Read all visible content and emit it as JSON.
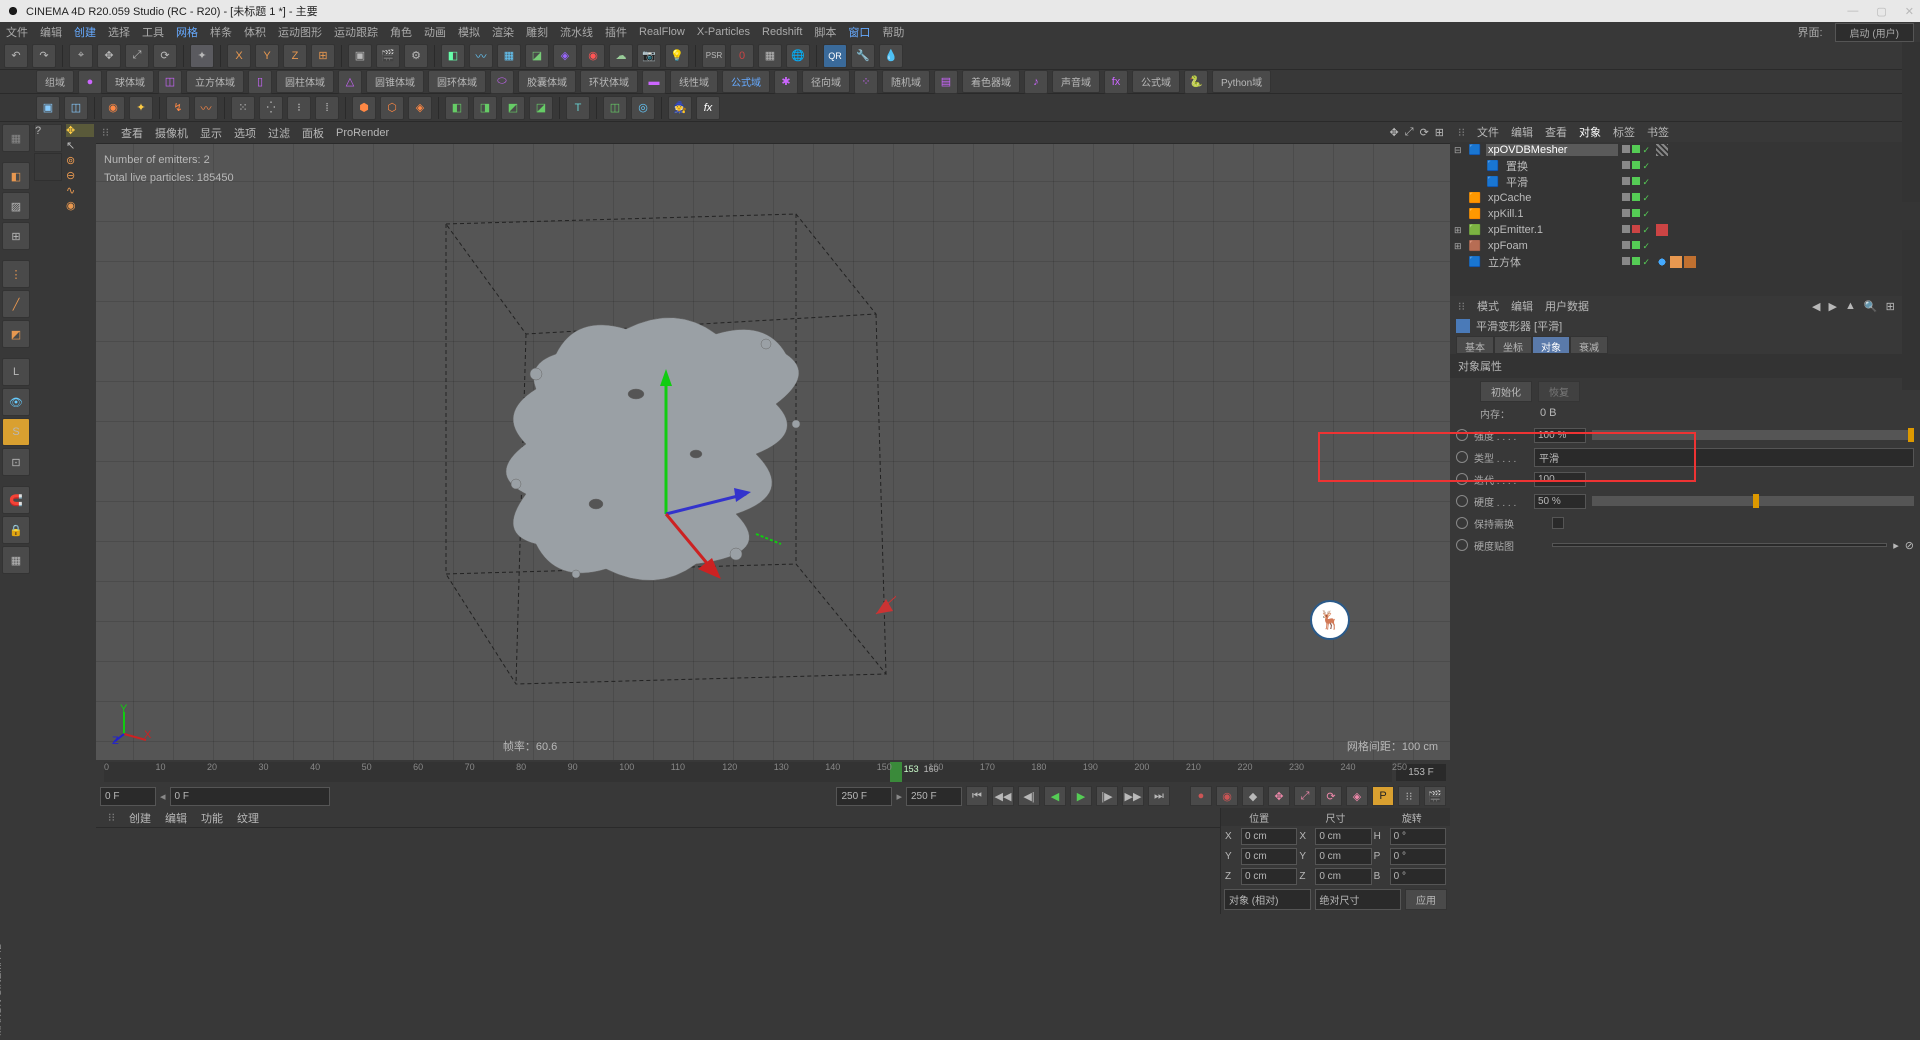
{
  "title": "CINEMA 4D R20.059 Studio (RC - R20) - [未标题 1 *] - 主要",
  "menu": [
    "文件",
    "编辑",
    "创建",
    "选择",
    "工具",
    "网格",
    "样条",
    "体积",
    "运动图形",
    "运动跟踪",
    "角色",
    "动画",
    "模拟",
    "渲染",
    "雕刻",
    "流水线",
    "插件",
    "RealFlow",
    "X-Particles",
    "Redshift",
    "脚本",
    "窗口",
    "帮助"
  ],
  "menu_right_label": "界面:",
  "menu_right_value": "启动 (用户)",
  "toolbar2": [
    "组域",
    "球体域",
    "立方体域",
    "圆柱体域",
    "圆锥体域",
    "圆环体域",
    "胶囊体域",
    "环状体域",
    "线性域",
    "公式域",
    "径向域",
    "随机域",
    "着色器域",
    "声音域",
    "公式域",
    "Python域"
  ],
  "vp_header": [
    "查看",
    "摄像机",
    "显示",
    "选项",
    "过滤",
    "面板",
    "ProRender"
  ],
  "vp_info_line1": "Number of emitters: 2",
  "vp_info_line2": "Total live particles: 185450",
  "vp_fps_label": "帧率：",
  "vp_fps": "60.6",
  "vp_grid_label": "网格间距：",
  "vp_grid": "100 cm",
  "timeline_current": "153",
  "timeline_end_frame": "160",
  "timeline_end_field": "153 F",
  "playback": {
    "start": "0 F",
    "start2": "0 F",
    "end1": "250 F",
    "end2": "250 F"
  },
  "rp_tabs": [
    "文件",
    "编辑",
    "查看",
    "对象",
    "标签",
    "书签"
  ],
  "hierarchy": [
    {
      "indent": 0,
      "exp": "⊟",
      "name": "xpOVDBMesher",
      "sel": true,
      "hicon": "🟦",
      "dots": [
        "grey",
        "green"
      ],
      "tags": [
        "dots"
      ]
    },
    {
      "indent": 1,
      "exp": "",
      "name": "置换",
      "hicon": "🟦",
      "dots": [
        "grey",
        "green"
      ],
      "tags": []
    },
    {
      "indent": 1,
      "exp": "",
      "name": "平滑",
      "hicon": "🟦",
      "dots": [
        "grey",
        "green"
      ],
      "tags": []
    },
    {
      "indent": 0,
      "exp": "",
      "name": "xpCache",
      "hicon": "🟧",
      "dots": [
        "grey",
        "green"
      ],
      "tags": []
    },
    {
      "indent": 0,
      "exp": "",
      "name": "xpKill.1",
      "hicon": "🟧",
      "dots": [
        "grey",
        "green"
      ],
      "tags": []
    },
    {
      "indent": 0,
      "exp": "⊞",
      "name": "xpEmitter.1",
      "hicon": "🟩",
      "dots": [
        "grey",
        "red"
      ],
      "tags": [
        "red"
      ]
    },
    {
      "indent": 0,
      "exp": "⊞",
      "name": "xpFoam",
      "hicon": "🟫",
      "dots": [
        "grey",
        "green"
      ],
      "tags": []
    },
    {
      "indent": 0,
      "exp": "",
      "name": "立方体",
      "hicon": "🟦",
      "dots": [
        "grey",
        "green"
      ],
      "tags": [
        "globe",
        "o1",
        "o2"
      ]
    }
  ],
  "attr_header": [
    "模式",
    "编辑",
    "用户数据"
  ],
  "attr_title": "平滑变形器 [平滑]",
  "attr_tabs": [
    "基本",
    "坐标",
    "对象",
    "衰减"
  ],
  "attr_tabs_active": 2,
  "attr_section": "对象属性",
  "attr": {
    "init_btn": "初始化",
    "recover_btn": "恢复",
    "memory_label": "内存：",
    "memory_value": "0 B",
    "strength_label": "强度 . . . .",
    "strength_value": "100 %",
    "type_label": "类型 . . . .",
    "type_value": "平滑",
    "iter_label": "迭代 . . . .",
    "iter_value": "100",
    "hard_label": "硬度 . . . .",
    "hard_value": "50 %",
    "keep_label": "保持需换",
    "hardmap_label": "硬度贴图"
  },
  "bottom_tabs": [
    "创建",
    "编辑",
    "功能",
    "纹理"
  ],
  "coord_headers": [
    "位置",
    "尺寸",
    "旋转"
  ],
  "coords": [
    {
      "axis": "X",
      "p": "0 cm",
      "s": "0 cm",
      "r_lbl": "H",
      "r": "0 °"
    },
    {
      "axis": "Y",
      "p": "0 cm",
      "s": "0 cm",
      "r_lbl": "P",
      "r": "0 °"
    },
    {
      "axis": "Z",
      "p": "0 cm",
      "s": "0 cm",
      "r_lbl": "B",
      "r": "0 °"
    }
  ],
  "coord_dd1": "对象 (相对)",
  "coord_dd2": "绝对尺寸",
  "coord_apply": "应用"
}
